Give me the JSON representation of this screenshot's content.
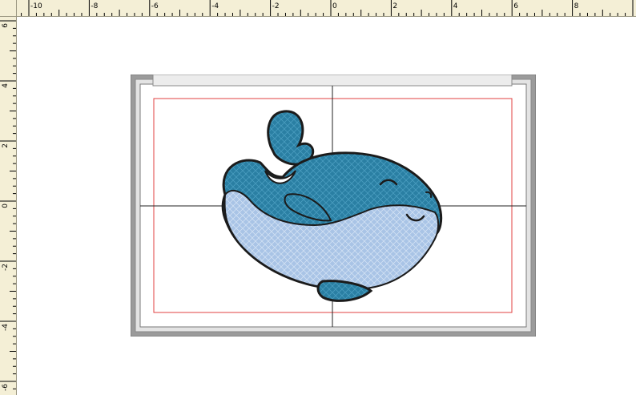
{
  "rulers": {
    "top_labels": [
      "-10",
      "-8",
      "-6",
      "-4",
      "-2",
      "0",
      "2",
      "4",
      "6",
      "8"
    ],
    "left_labels": [
      "6",
      "4",
      "2",
      "0",
      "-2",
      "-4",
      "-6"
    ]
  },
  "colors": {
    "ruler_bg": "#f4efd6",
    "hoop_frame": "#9b9b9b",
    "sew_boundary": "#e04040",
    "whale_dark": "#2a7fa3",
    "whale_light": "#a9c4e6",
    "outline": "#1b1b1b"
  },
  "icons": {
    "design": "whale-embroidery-icon"
  }
}
